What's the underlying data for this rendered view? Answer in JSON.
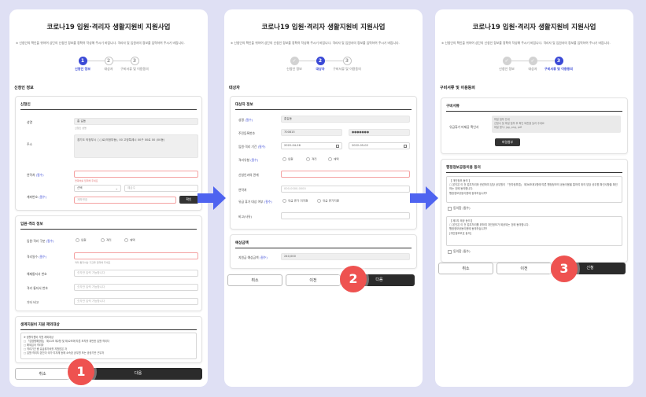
{
  "title": "코로나19 입원·격리자 생활지원비 지원사업",
  "intro": "※ 신청인의 확인을 위하여 상단의 신청인 정보를 정확히 작성해 주시기 바랍니다. 격리자 및 입원자의 정보를 입력하여 주시기 바랍니다.",
  "steps": [
    "신청인 정보",
    "대상자",
    "구비서류 및 이용동의"
  ],
  "colors": {
    "accent": "#3a49d6",
    "badge": "#ee5250",
    "arrow": "#4e63f0",
    "dark_button": "#2b2b2b"
  },
  "panel1": {
    "section": "신청인 정보",
    "card1": {
      "title": "신청인",
      "name_label": "성명",
      "name_value": "홍 길동",
      "name_hint": "신청인 성명",
      "address_label": "주소",
      "address_value": "경기도 의정부시 ○○로(의정부동), 00 고양특례시 00구 00로 00 (00동)",
      "phone_label": "연락처",
      "phone_hint": "연락처를 입력해 주세요",
      "account_label": "계좌번호",
      "bank_select": "선택",
      "holder_placeholder": "예금주",
      "account_placeholder": "계좌번호",
      "verify_button": "확인"
    },
    "card2": {
      "title": "입원·격리 정보",
      "type_label": "입원·격리 구분",
      "radios": [
        "입원",
        "격리",
        "재택"
      ],
      "reason_label": "격리일수",
      "reason_hint": "격리 통지서상 기간을 입력해 주세요",
      "l1": "해제통지서 번호",
      "l2": "격리 통지서 번호",
      "l3": "기타 비고",
      "placeholder": "숫자만 입력 가능합니다"
    },
    "card3": {
      "title": "생계지원비 지원 제외대상",
      "lines": [
        "※ 생활지원비 지원 제외대상",
        "□ 「감염병예방법」 제41조 제2항 및 제42조에 따른 조치를 위반한 입원·격리자",
        "□ 해외입국 격리자",
        "□ 격리기간 중 유급휴가비를 지원받은 자",
        "□ 입원·격리자 본인이 국가·지자체 등에 소속된 공무원 또는 공공기관 근무자"
      ]
    },
    "buttons": {
      "cancel": "취소",
      "next": "다음"
    },
    "badge": "1"
  },
  "panel2": {
    "section": "대상자",
    "card1": {
      "title": "대상자 정보",
      "name_label": "성명",
      "name_value": "홍길동",
      "rrn_label": "주민등록번호",
      "rrn_front": "700815",
      "rrn_back": "●●●●●●●",
      "period_label": "입원·격리 기간",
      "date_from": "2022-04-26",
      "date_to": "2022-05-02",
      "type_label": "격리유형",
      "radios": [
        "입원",
        "격리",
        "재택"
      ],
      "rel_label": "신청인과의 관계",
      "phone_label": "연락처",
      "phone_placeholder": "000-0000-0000",
      "vacation_label": "유급 휴가 대상 여부",
      "vac_radios": [
        "유급 휴가 미지원",
        "유급 휴가지원"
      ],
      "note_label": "비고(사유)"
    },
    "card2": {
      "title": "예상금액",
      "amount_label": "지원금 예상금액",
      "amount_value": "240,000"
    },
    "buttons": {
      "cancel": "취소",
      "prev": "이전",
      "next": "다음"
    },
    "badge": "2"
  },
  "panel3": {
    "section": "구비서류 및 이용동의",
    "card1": {
      "title": "구비서류",
      "doc_label": "유급휴가 미제공 확인서",
      "upload_lines": [
        "파일 첨부 안내",
        "신청서 및 파일 첨부 후 확인 버튼을 눌러 주세요",
        "파일 형식: jpg, png, pdf"
      ],
      "upload_button": "파일첨부"
    },
    "card2": {
      "title": "행정정보공동이용 동의",
      "notice1": [
        "【 개인정보 동의 】",
        "□ 본인은 이 건 업무처리와 관련하여 담당 공무원이 「전자정부법」 제36조제1항에 따른 행정정보의 공동이용을 통하여 위의 담당 공무원 확인사항을 확인하는 것에 동의합니다.",
        "행정정보공동이용에 동의하십니까?"
      ],
      "agree1": "동의함 (필수)",
      "notice2": [
        "【 제3자 제공 동의 】",
        "□ 본인은 이 건 업무처리를 위하여 개인정보가 제공되는 것에 동의합니다.",
        "행정정보공동이용에 동의하십니까?",
        "[개인정보보호 동의]"
      ],
      "agree2": "동의함 (필수)"
    },
    "buttons": {
      "cancel": "취소",
      "prev": "이전",
      "submit": "신청"
    },
    "badge": "3"
  }
}
